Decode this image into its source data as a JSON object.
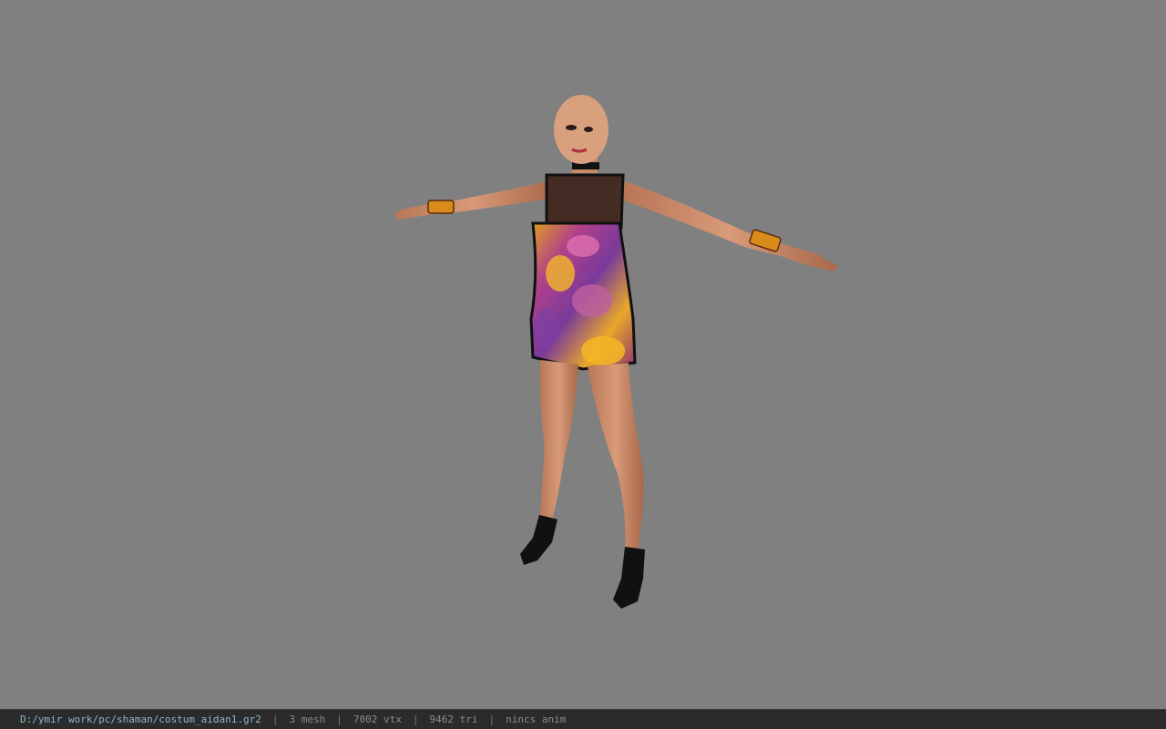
{
  "viewport": {
    "background": "#808080",
    "model_icon": "character-model"
  },
  "statusbar": {
    "file_path": "D:/ymir work/pc/shaman/costum_aidan1.gr2",
    "separator": "|",
    "mesh_count": "3 mesh",
    "vertex_count": "7002 vtx",
    "triangle_count": "9462 tri",
    "anim_status": "nincs anim"
  }
}
